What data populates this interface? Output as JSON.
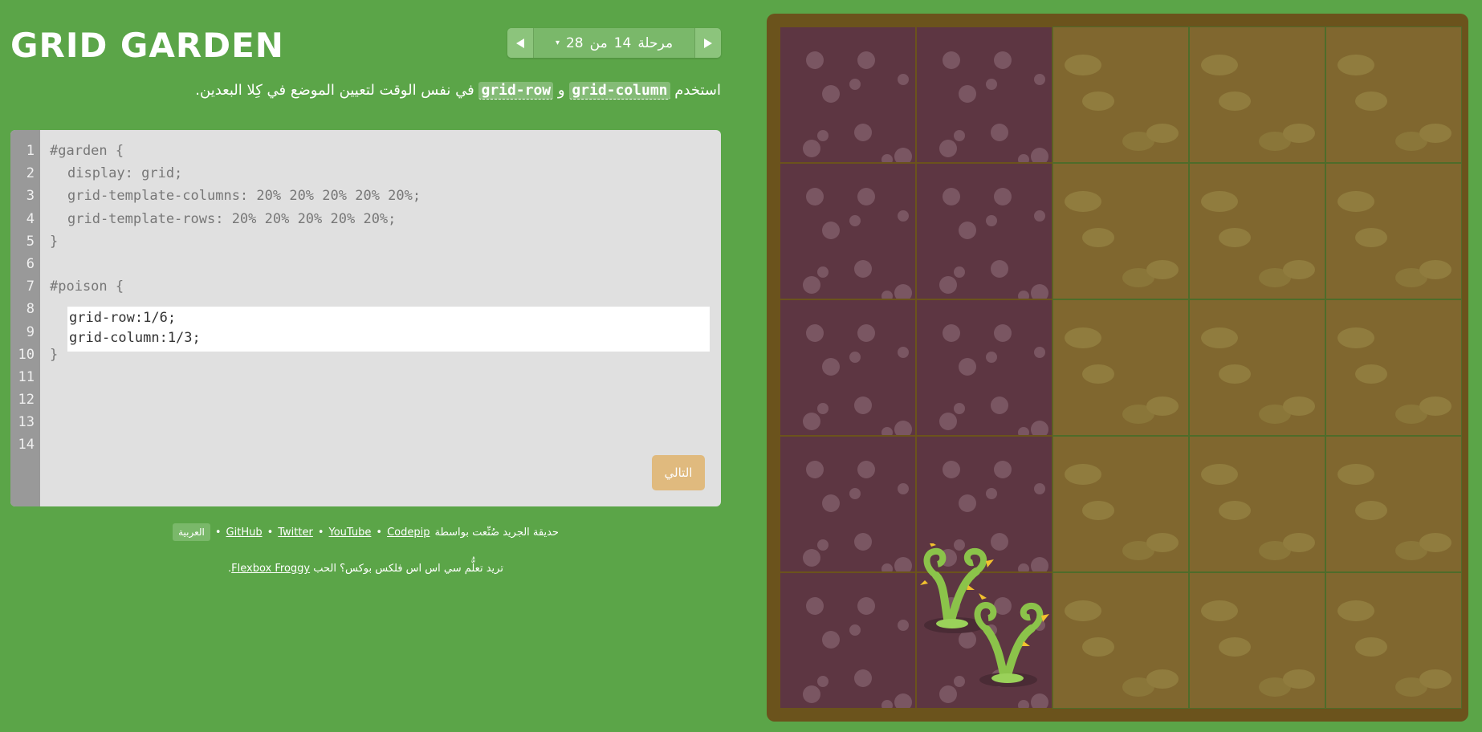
{
  "app": {
    "title": "GRID GARDEN"
  },
  "level_nav": {
    "label": "مرحلة",
    "current": "14",
    "of": "من",
    "total": "28",
    "caret": "▾"
  },
  "instructions": {
    "before": "استخدم",
    "code1": "grid-column",
    "conj": "و",
    "code2": "grid-row",
    "after": "في نفس الوقت لتعيين الموضع في كِلا البعدين."
  },
  "editor": {
    "line_numbers": [
      "1",
      "2",
      "3",
      "4",
      "5",
      "6",
      "7",
      "8",
      "9",
      "10",
      "11",
      "12",
      "13",
      "14"
    ],
    "lines": [
      "#garden {",
      "display: grid;",
      "grid-template-columns: 20% 20% 20% 20% 20%;",
      "grid-template-rows: 20% 20% 20% 20% 20%;",
      "}",
      "",
      "#poison {"
    ],
    "closing_brace": "}",
    "input_value": "grid-row:1/6;\ngrid-column:1/3;",
    "next_label": "التالي"
  },
  "credits": {
    "prefix": "حديقة الجريد صُنِّعت بواسطة",
    "links": [
      "Codepip",
      "YouTube",
      "Twitter",
      "GitHub"
    ],
    "separator": "•",
    "language": "العربية"
  },
  "froggy": {
    "prefix": "تريد تعلُّم سي اس اس فلكس بوكس؟ الحب",
    "link": "Flexbox Froggy",
    "suffix": "."
  },
  "garden": {
    "columns": 5,
    "rows": 5,
    "poison_cells": "rows 1-5, columns 1-2",
    "colors": {
      "soil": "#80672f",
      "poison": "#5d3642",
      "frame": "#6b531c",
      "background": "#5ba548"
    }
  }
}
